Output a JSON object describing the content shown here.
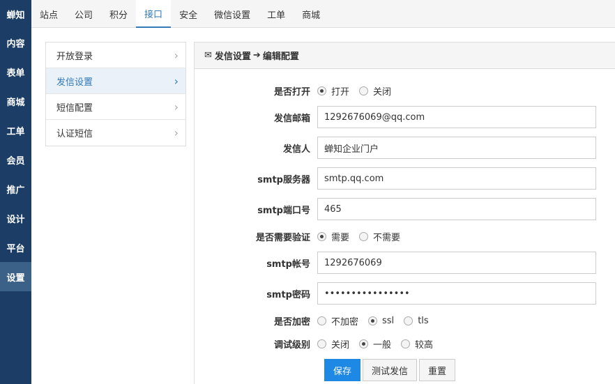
{
  "left_nav": {
    "items": [
      {
        "label": "蝉知"
      },
      {
        "label": "内容"
      },
      {
        "label": "表单"
      },
      {
        "label": "商城"
      },
      {
        "label": "工单"
      },
      {
        "label": "会员"
      },
      {
        "label": "推广"
      },
      {
        "label": "设计"
      },
      {
        "label": "平台"
      },
      {
        "label": "设置"
      }
    ]
  },
  "top_nav": {
    "tabs": [
      {
        "label": "站点"
      },
      {
        "label": "公司"
      },
      {
        "label": "积分"
      },
      {
        "label": "接口"
      },
      {
        "label": "安全"
      },
      {
        "label": "微信设置"
      },
      {
        "label": "工单"
      },
      {
        "label": "商城"
      }
    ]
  },
  "side_menu": {
    "items": [
      {
        "label": "开放登录"
      },
      {
        "label": "发信设置"
      },
      {
        "label": "短信配置"
      },
      {
        "label": "认证短信"
      }
    ]
  },
  "panel": {
    "title_part1": "发信设置",
    "title_part2": "编辑配置"
  },
  "form": {
    "enable": {
      "label": "是否打开",
      "options": [
        "打开",
        "关闭"
      ],
      "selected": 0
    },
    "email": {
      "label": "发信邮箱",
      "value": "1292676069@qq.com"
    },
    "sender": {
      "label": "发信人",
      "value": "蝉知企业门户"
    },
    "smtp_server": {
      "label": "smtp服务器",
      "value": "smtp.qq.com"
    },
    "smtp_port": {
      "label": "smtp端口号",
      "value": "465"
    },
    "auth": {
      "label": "是否需要验证",
      "options": [
        "需要",
        "不需要"
      ],
      "selected": 0
    },
    "smtp_account": {
      "label": "smtp帐号",
      "value": "1292676069"
    },
    "smtp_password": {
      "label": "smtp密码",
      "value": "••••••••••••••••"
    },
    "encryption": {
      "label": "是否加密",
      "options": [
        "不加密",
        "ssl",
        "tls"
      ],
      "selected": 1
    },
    "debug": {
      "label": "调试级别",
      "options": [
        "关闭",
        "一般",
        "较高"
      ],
      "selected": 1
    }
  },
  "buttons": {
    "save": "保存",
    "test": "测试发信",
    "reset": "重置"
  }
}
